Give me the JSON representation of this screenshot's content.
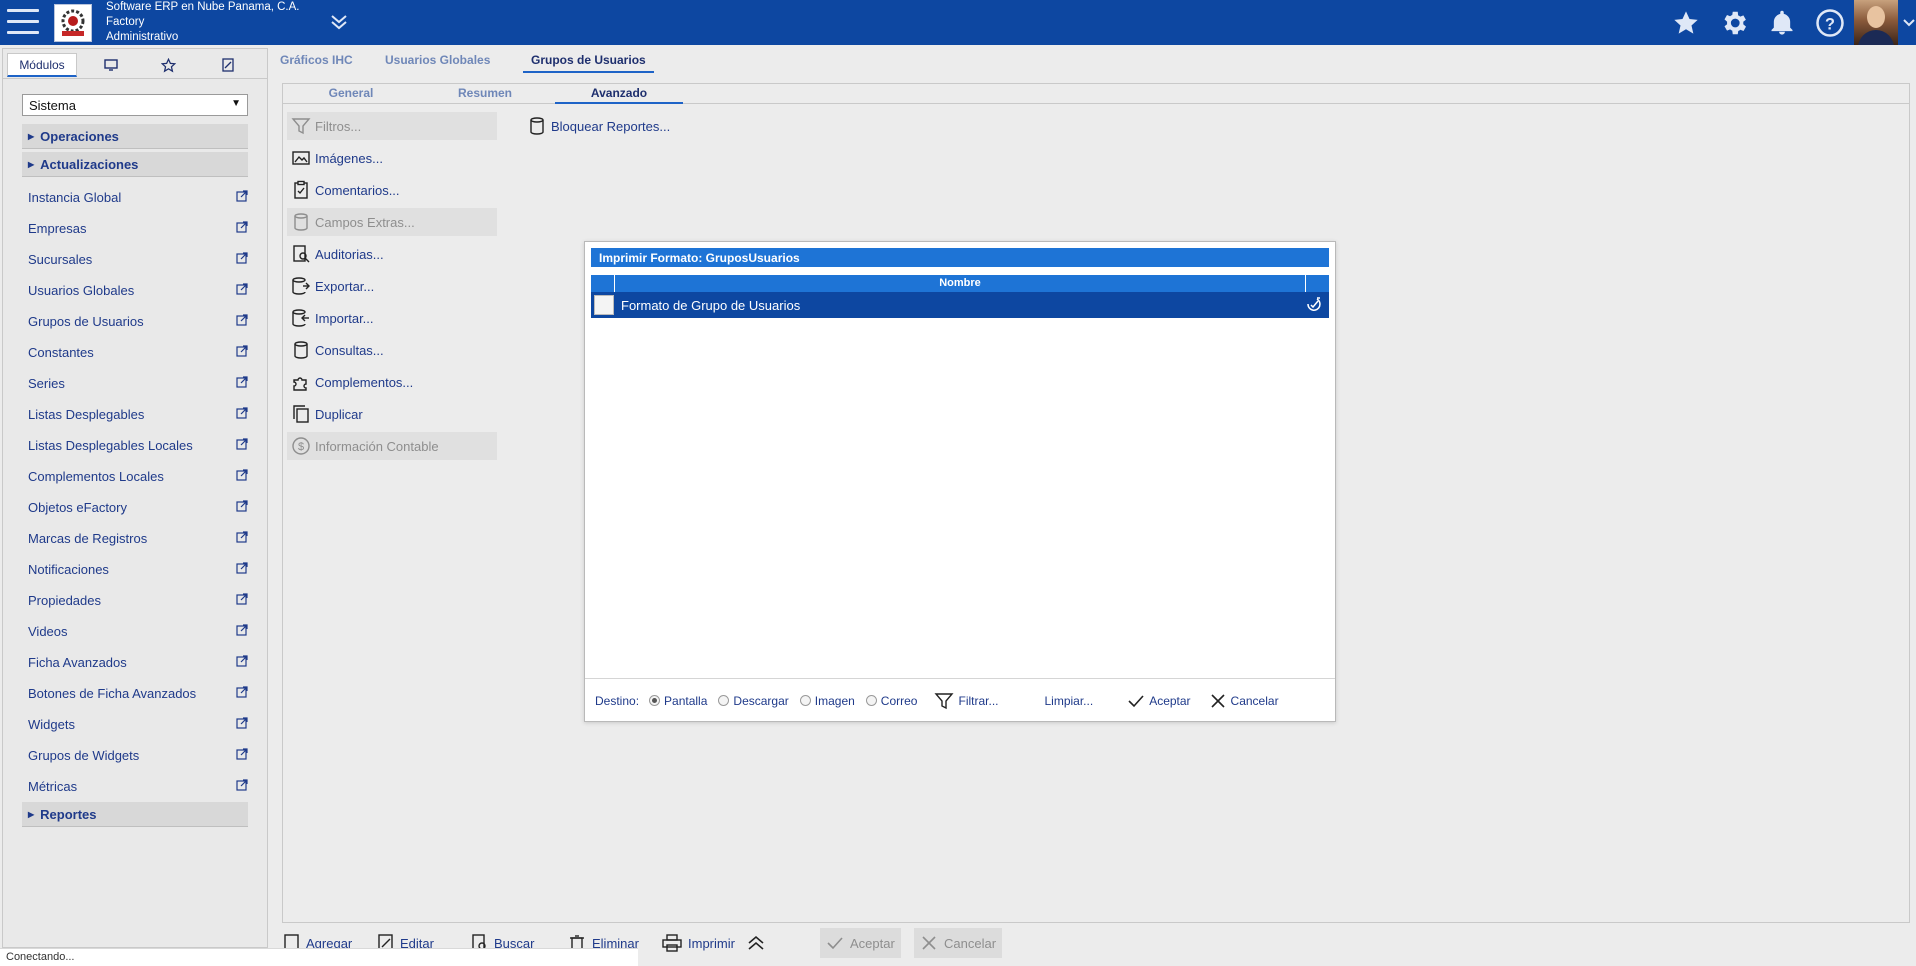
{
  "header": {
    "company_line1": "Software ERP en Nube Panama, C.A.",
    "company_line2": "Factory",
    "company_line3": "Administrativo",
    "colors": {
      "bar": "#0d47a1"
    },
    "icons": [
      "star-icon",
      "gear-icon",
      "bell-icon",
      "help-icon"
    ]
  },
  "sidebar": {
    "tabs": [
      "Módulos",
      "monitor-icon",
      "star-icon",
      "edit-icon"
    ],
    "select_value": "Sistema",
    "sections": {
      "operaciones": "Operaciones",
      "actualizaciones": "Actualizaciones",
      "reportes": "Reportes"
    },
    "items": [
      "Instancia Global",
      "Empresas",
      "Sucursales",
      "Usuarios Globales",
      "Grupos de Usuarios",
      "Constantes",
      "Series",
      "Listas Desplegables",
      "Listas Desplegables Locales",
      "Complementos Locales",
      "Objetos eFactory",
      "Marcas de Registros",
      "Notificaciones",
      "Propiedades",
      "Videos",
      "Ficha Avanzados",
      "Botones de Ficha Avanzados",
      "Widgets",
      "Grupos de Widgets",
      "Métricas"
    ]
  },
  "main": {
    "tabs": [
      "Gráficos IHC",
      "Usuarios Globales",
      "Grupos de Usuarios"
    ],
    "subtabs": [
      "General",
      "Resumen",
      "Avanzado"
    ],
    "actions": {
      "filtros": "Filtros...",
      "imagenes": "Imágenes...",
      "comentarios": "Comentarios...",
      "campos_extras": "Campos Extras...",
      "auditorias": "Auditorias...",
      "exportar": "Exportar...",
      "importar": "Importar...",
      "consultas": "Consultas...",
      "complementos": "Complementos...",
      "duplicar": "Duplicar",
      "informacion_contable": "Información Contable",
      "bloquear_reportes": "Bloquear Reportes..."
    }
  },
  "modal": {
    "title": "Imprimir Formato: GruposUsuarios",
    "column": "Nombre",
    "row": "Formato de Grupo de Usuarios",
    "destino_label": "Destino:",
    "options": [
      "Pantalla",
      "Descargar",
      "Imagen",
      "Correo"
    ],
    "selected": "Pantalla",
    "filtrar": "Filtrar...",
    "limpiar": "Limpiar...",
    "aceptar": "Aceptar",
    "cancelar": "Cancelar"
  },
  "toolbar": {
    "agregar": "Agregar",
    "editar": "Editar",
    "buscar": "Buscar",
    "eliminar": "Eliminar",
    "imprimir": "Imprimir",
    "aceptar": "Aceptar",
    "cancelar": "Cancelar"
  },
  "status": "Conectando..."
}
